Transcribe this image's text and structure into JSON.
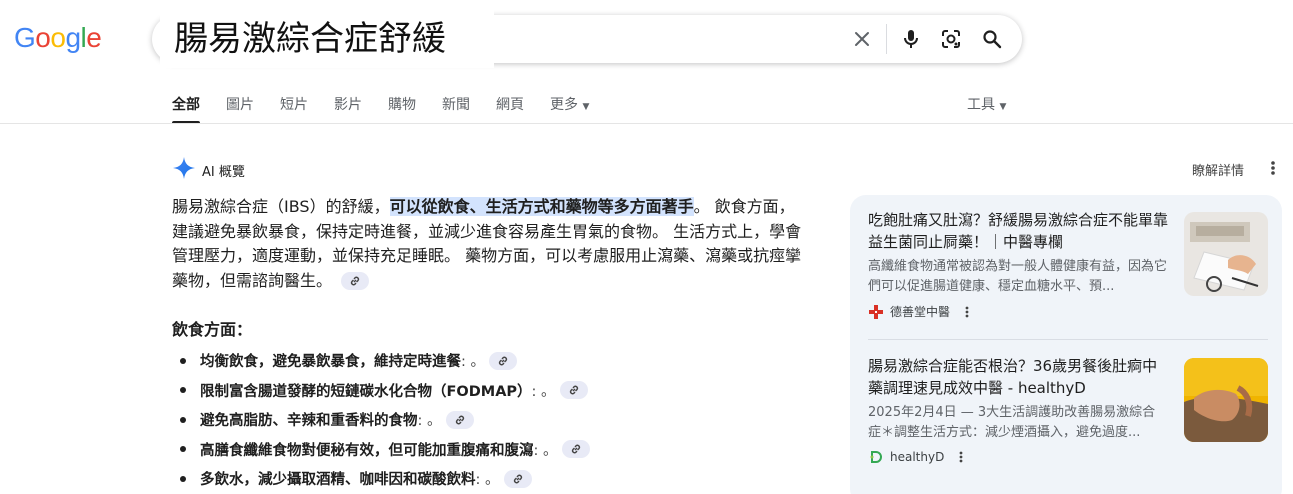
{
  "logo": {
    "letters": [
      "G",
      "o",
      "o",
      "g",
      "l",
      "e"
    ],
    "colors": [
      "#4285F4",
      "#EA4335",
      "#FBBC05",
      "#4285F4",
      "#34A853",
      "#EA4335"
    ]
  },
  "search": {
    "query": "腸易激綜合症舒緩",
    "clear_icon": "close-icon",
    "voice_icon": "mic-icon",
    "lens_icon": "camera-lens-icon",
    "search_icon": "search-icon"
  },
  "tabs": [
    "全部",
    "圖片",
    "短片",
    "影片",
    "購物",
    "新聞",
    "網頁",
    "更多"
  ],
  "tools_label": "工具",
  "ai": {
    "title": "AI 概覽",
    "learn_more": "瞭解詳情",
    "intro_prefix": "腸易激綜合症（IBS）的舒緩，",
    "intro_highlight": "可以從飲食、生活方式和藥物等多方面著手",
    "intro_suffix": "。 飲食方面，建議避免暴飲暴食，保持定時進餐，並減少進食容易產生胃氣的食物。 生活方式上，學會管理壓力，適度運動，並保持充足睡眠。 藥物方面，可以考慮服用止瀉藥、瀉藥或抗痙攣藥物，但需諮詢醫生。",
    "diet_title": "飲食方面：",
    "bullets": [
      {
        "bold": "均衡飲食，避免暴飲暴食，維持定時進餐",
        "tail": ": 。"
      },
      {
        "bold": "限制富含腸道發酵的短鏈碳水化合物（FODMAP）",
        "tail": ": 。"
      },
      {
        "bold": "避免高脂肪、辛辣和重香料的食物",
        "tail": ": 。"
      },
      {
        "bold": "高膳食纖維食物對便秘有效，但可能加重腹痛和腹瀉",
        "tail": ": 。"
      },
      {
        "bold": "多飲水，減少攝取酒精、咖啡因和碳酸飲料",
        "tail": ": 。"
      }
    ]
  },
  "sources": [
    {
      "title": "吃飽肚痛又肚瀉？舒緩腸易激綜合症不能單靠益生菌同止屙藥！｜中醫專欄",
      "snippet": "高纖維食物通常被認為對一般人體健康有益，因為它們可以促進腸道健康、穩定血糖水平、預...",
      "source": "德善堂中醫",
      "accent": "#d93025"
    },
    {
      "title": "腸易激綜合症能否根治？36歲男餐後肚痾中藥調理速見成效中醫 - healthyD",
      "snippet": "2025年2月4日 — 3大生活調護助改善腸易激綜合症＊調整生活方式：減少煙酒攝入，避免過度...",
      "source": "healthyD",
      "accent": "#34a853"
    }
  ]
}
